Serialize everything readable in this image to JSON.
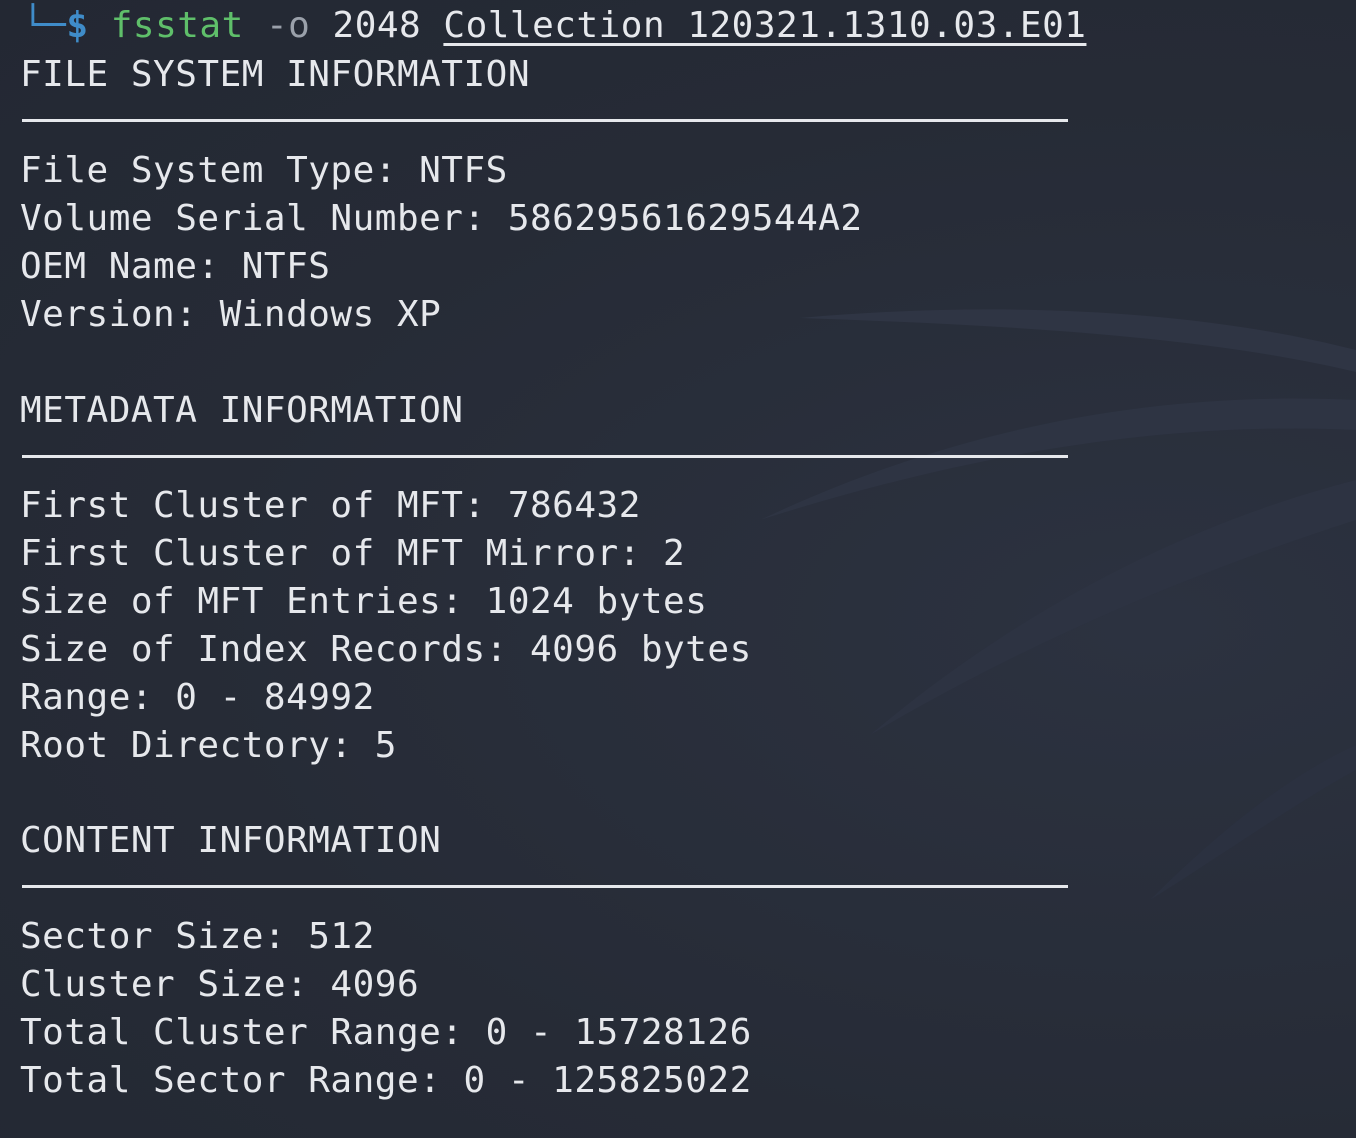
{
  "prompt": {
    "corner_glyph": "└─",
    "symbol": "$",
    "command": "fsstat",
    "flag": "-o",
    "offset": "2048",
    "image_file": "Collection 120321.1310.03.E01"
  },
  "sections": [
    {
      "header": "FILE SYSTEM INFORMATION",
      "lines": [
        "File System Type: NTFS",
        "Volume Serial Number: 58629561629544A2",
        "OEM Name: NTFS",
        "Version: Windows XP"
      ]
    },
    {
      "header": "METADATA INFORMATION",
      "lines": [
        "First Cluster of MFT: 786432",
        "First Cluster of MFT Mirror: 2",
        "Size of MFT Entries: 1024 bytes",
        "Size of Index Records: 4096 bytes",
        "Range: 0 - 84992",
        "Root Directory: 5"
      ]
    },
    {
      "header": "CONTENT INFORMATION",
      "lines": [
        "Sector Size: 512",
        "Cluster Size: 4096",
        "Total Cluster Range: 0 - 15728126",
        "Total Sector Range: 0 - 125825022"
      ]
    }
  ],
  "colors": {
    "background": "#262b36",
    "text": "#e6e8ec",
    "command": "#5fbf6a",
    "prompt": "#3f8cc9",
    "flag": "#9aa0aa"
  }
}
